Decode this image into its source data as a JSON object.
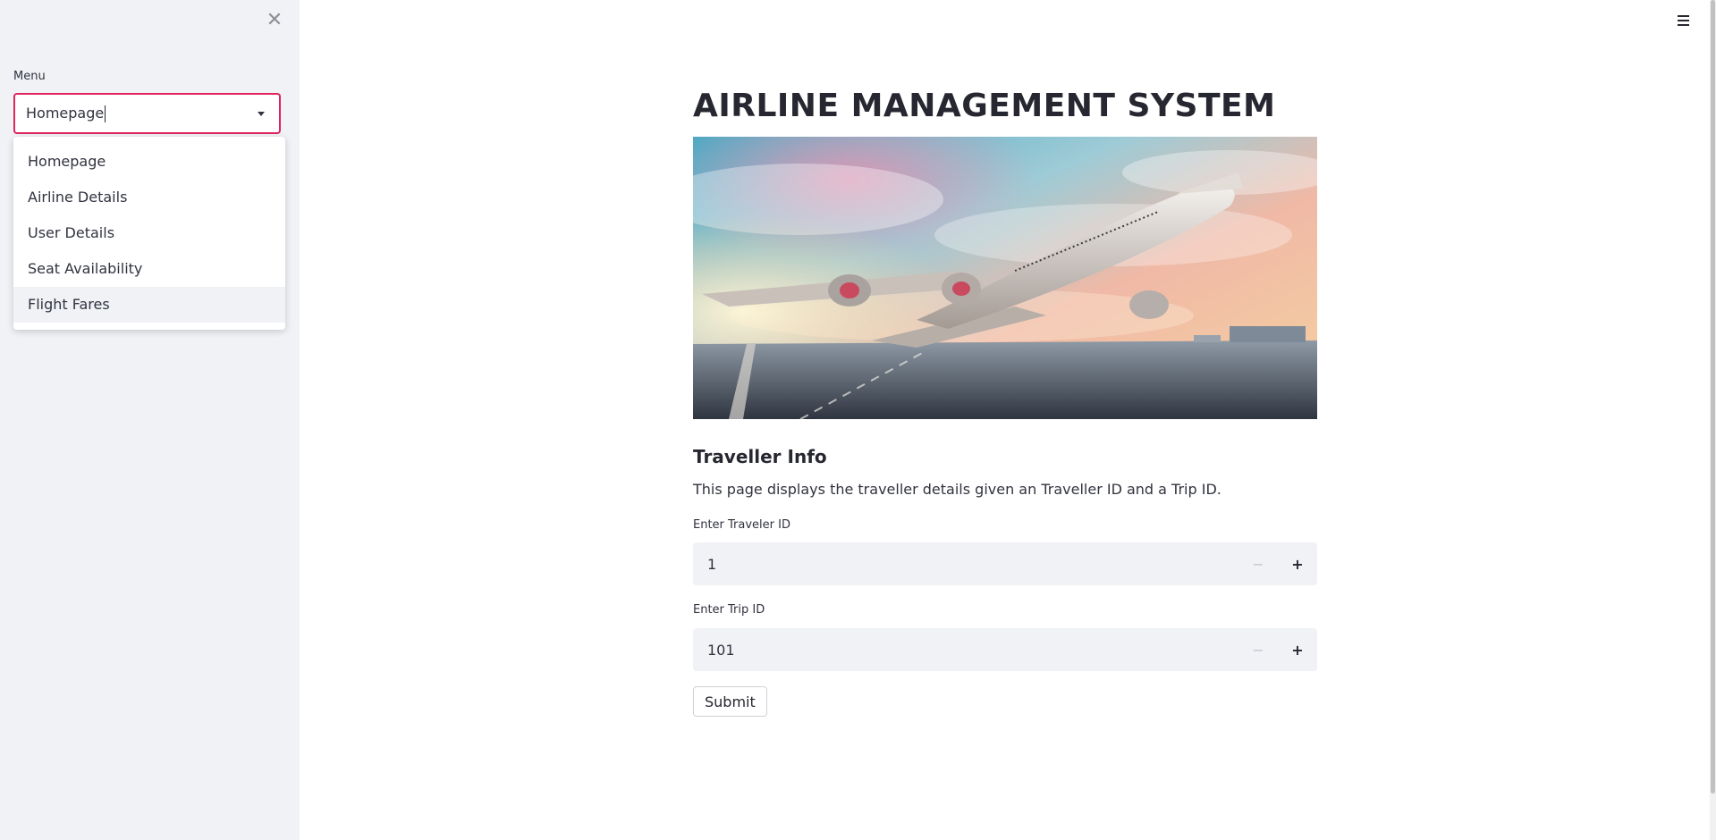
{
  "sidebar": {
    "menu_label": "Menu",
    "select": {
      "value": "Homepage",
      "options": [
        "Homepage",
        "Airline Details",
        "User Details",
        "Seat Availability",
        "Flight Fares"
      ],
      "highlighted": "Flight Fares"
    }
  },
  "main": {
    "title": "AIRLINE MANAGEMENT SYSTEM",
    "subheader": "Traveller Info",
    "description": "This page displays the traveller details given an Traveller ID and a Trip ID.",
    "traveler_id": {
      "label": "Enter Traveler ID",
      "value": "1",
      "minus": "−",
      "plus": "+"
    },
    "trip_id": {
      "label": "Enter Trip ID",
      "value": "101",
      "minus": "−",
      "plus": "+"
    },
    "submit_label": "Submit"
  },
  "colors": {
    "accent": "#e0245e",
    "sidebar_bg": "#f0f2f6",
    "text": "#262730"
  },
  "icons": {
    "close": "close-icon",
    "menu": "hamburger-menu-icon",
    "dropdown": "chevron-down-icon"
  }
}
